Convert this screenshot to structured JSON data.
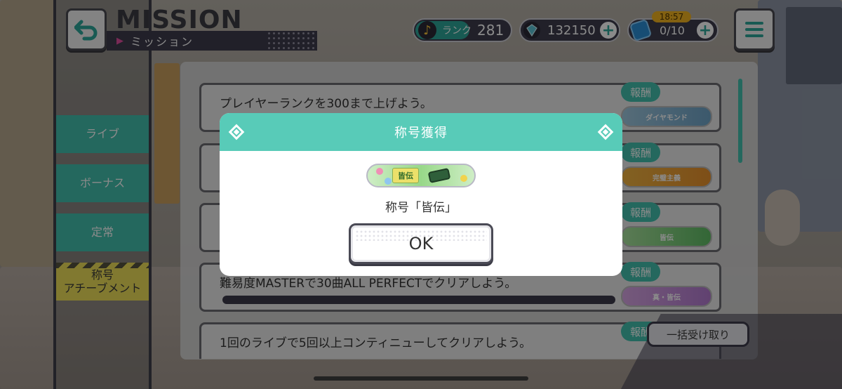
{
  "header": {
    "title_en": "MISSION",
    "title_jp": "ミッション",
    "rank_label": "ランク",
    "rank_value": "281",
    "gems": "132150",
    "stamina": "0/10",
    "stamina_timer": "18:57"
  },
  "sidebar": {
    "items": [
      {
        "label": "ライブ"
      },
      {
        "label": "ボーナス"
      },
      {
        "label": "定常"
      },
      {
        "label": "称号\nアチーブメント"
      }
    ]
  },
  "missions": [
    {
      "text": "プレイヤーランクを300まで上げよう。",
      "reward_label": "報酬",
      "reward": "ダイヤモンド"
    },
    {
      "text": "",
      "reward_label": "報酬",
      "reward": "完璧主義"
    },
    {
      "text": "",
      "reward_label": "報酬",
      "reward": "皆伝"
    },
    {
      "text": "難易度MASTERで30曲ALL PERFECTでクリアしよう。",
      "reward_label": "報酬",
      "reward": "真・皆伝"
    },
    {
      "text": "1回のライブで5回以上コンティニューしてクリアしよう。",
      "reward_label": "報酬",
      "reward": ""
    }
  ],
  "bulk_button": "一括受け取り",
  "modal": {
    "title": "称号獲得",
    "badge": "皆伝",
    "message": "称号「皆伝」",
    "ok": "OK"
  },
  "colors": {
    "accent": "#58cbb8",
    "active_tab": "#efe059",
    "dark": "#3d3b4c"
  }
}
